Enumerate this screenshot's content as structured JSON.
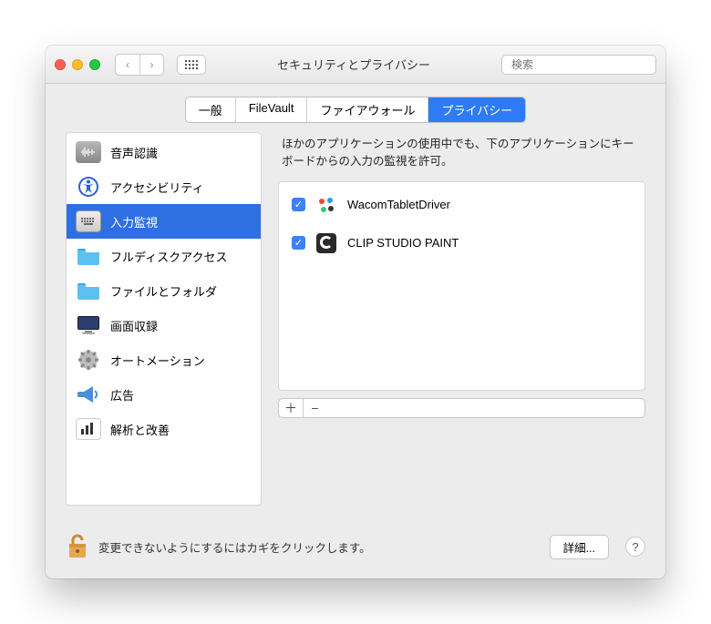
{
  "window": {
    "title": "セキュリティとプライバシー",
    "search_placeholder": "検索"
  },
  "tabs": [
    {
      "id": "general",
      "label": "一般"
    },
    {
      "id": "filevault",
      "label": "FileVault"
    },
    {
      "id": "firewall",
      "label": "ファイアウォール"
    },
    {
      "id": "privacy",
      "label": "プライバシー",
      "active": true
    }
  ],
  "sidebar": {
    "items": [
      {
        "id": "speech",
        "label": "音声認識",
        "icon": "waveform"
      },
      {
        "id": "a11y",
        "label": "アクセシビリティ",
        "icon": "accessibility"
      },
      {
        "id": "input",
        "label": "入力監視",
        "icon": "keyboard",
        "selected": true
      },
      {
        "id": "fulldisk",
        "label": "フルディスクアクセス",
        "icon": "folder"
      },
      {
        "id": "files",
        "label": "ファイルとフォルダ",
        "icon": "folder"
      },
      {
        "id": "screen",
        "label": "画面収録",
        "icon": "monitor"
      },
      {
        "id": "automation",
        "label": "オートメーション",
        "icon": "gear"
      },
      {
        "id": "ads",
        "label": "広告",
        "icon": "megaphone"
      },
      {
        "id": "analytics",
        "label": "解析と改善",
        "icon": "bars"
      }
    ]
  },
  "right": {
    "description": "ほかのアプリケーションの使用中でも、下のアプリケーションにキーボードからの入力の監視を許可。",
    "apps": [
      {
        "name": "WacomTabletDriver",
        "checked": true,
        "icon": "wacom"
      },
      {
        "name": "CLIP STUDIO PAINT",
        "checked": true,
        "icon": "clipstudio"
      }
    ]
  },
  "footer": {
    "lock_text": "変更できないようにするにはカギをクリックします。",
    "details": "詳細...",
    "help": "?"
  },
  "glyphs": {
    "plus": "＋",
    "minus": "−",
    "check": "✓",
    "chev_left": "‹",
    "chev_right": "›"
  }
}
